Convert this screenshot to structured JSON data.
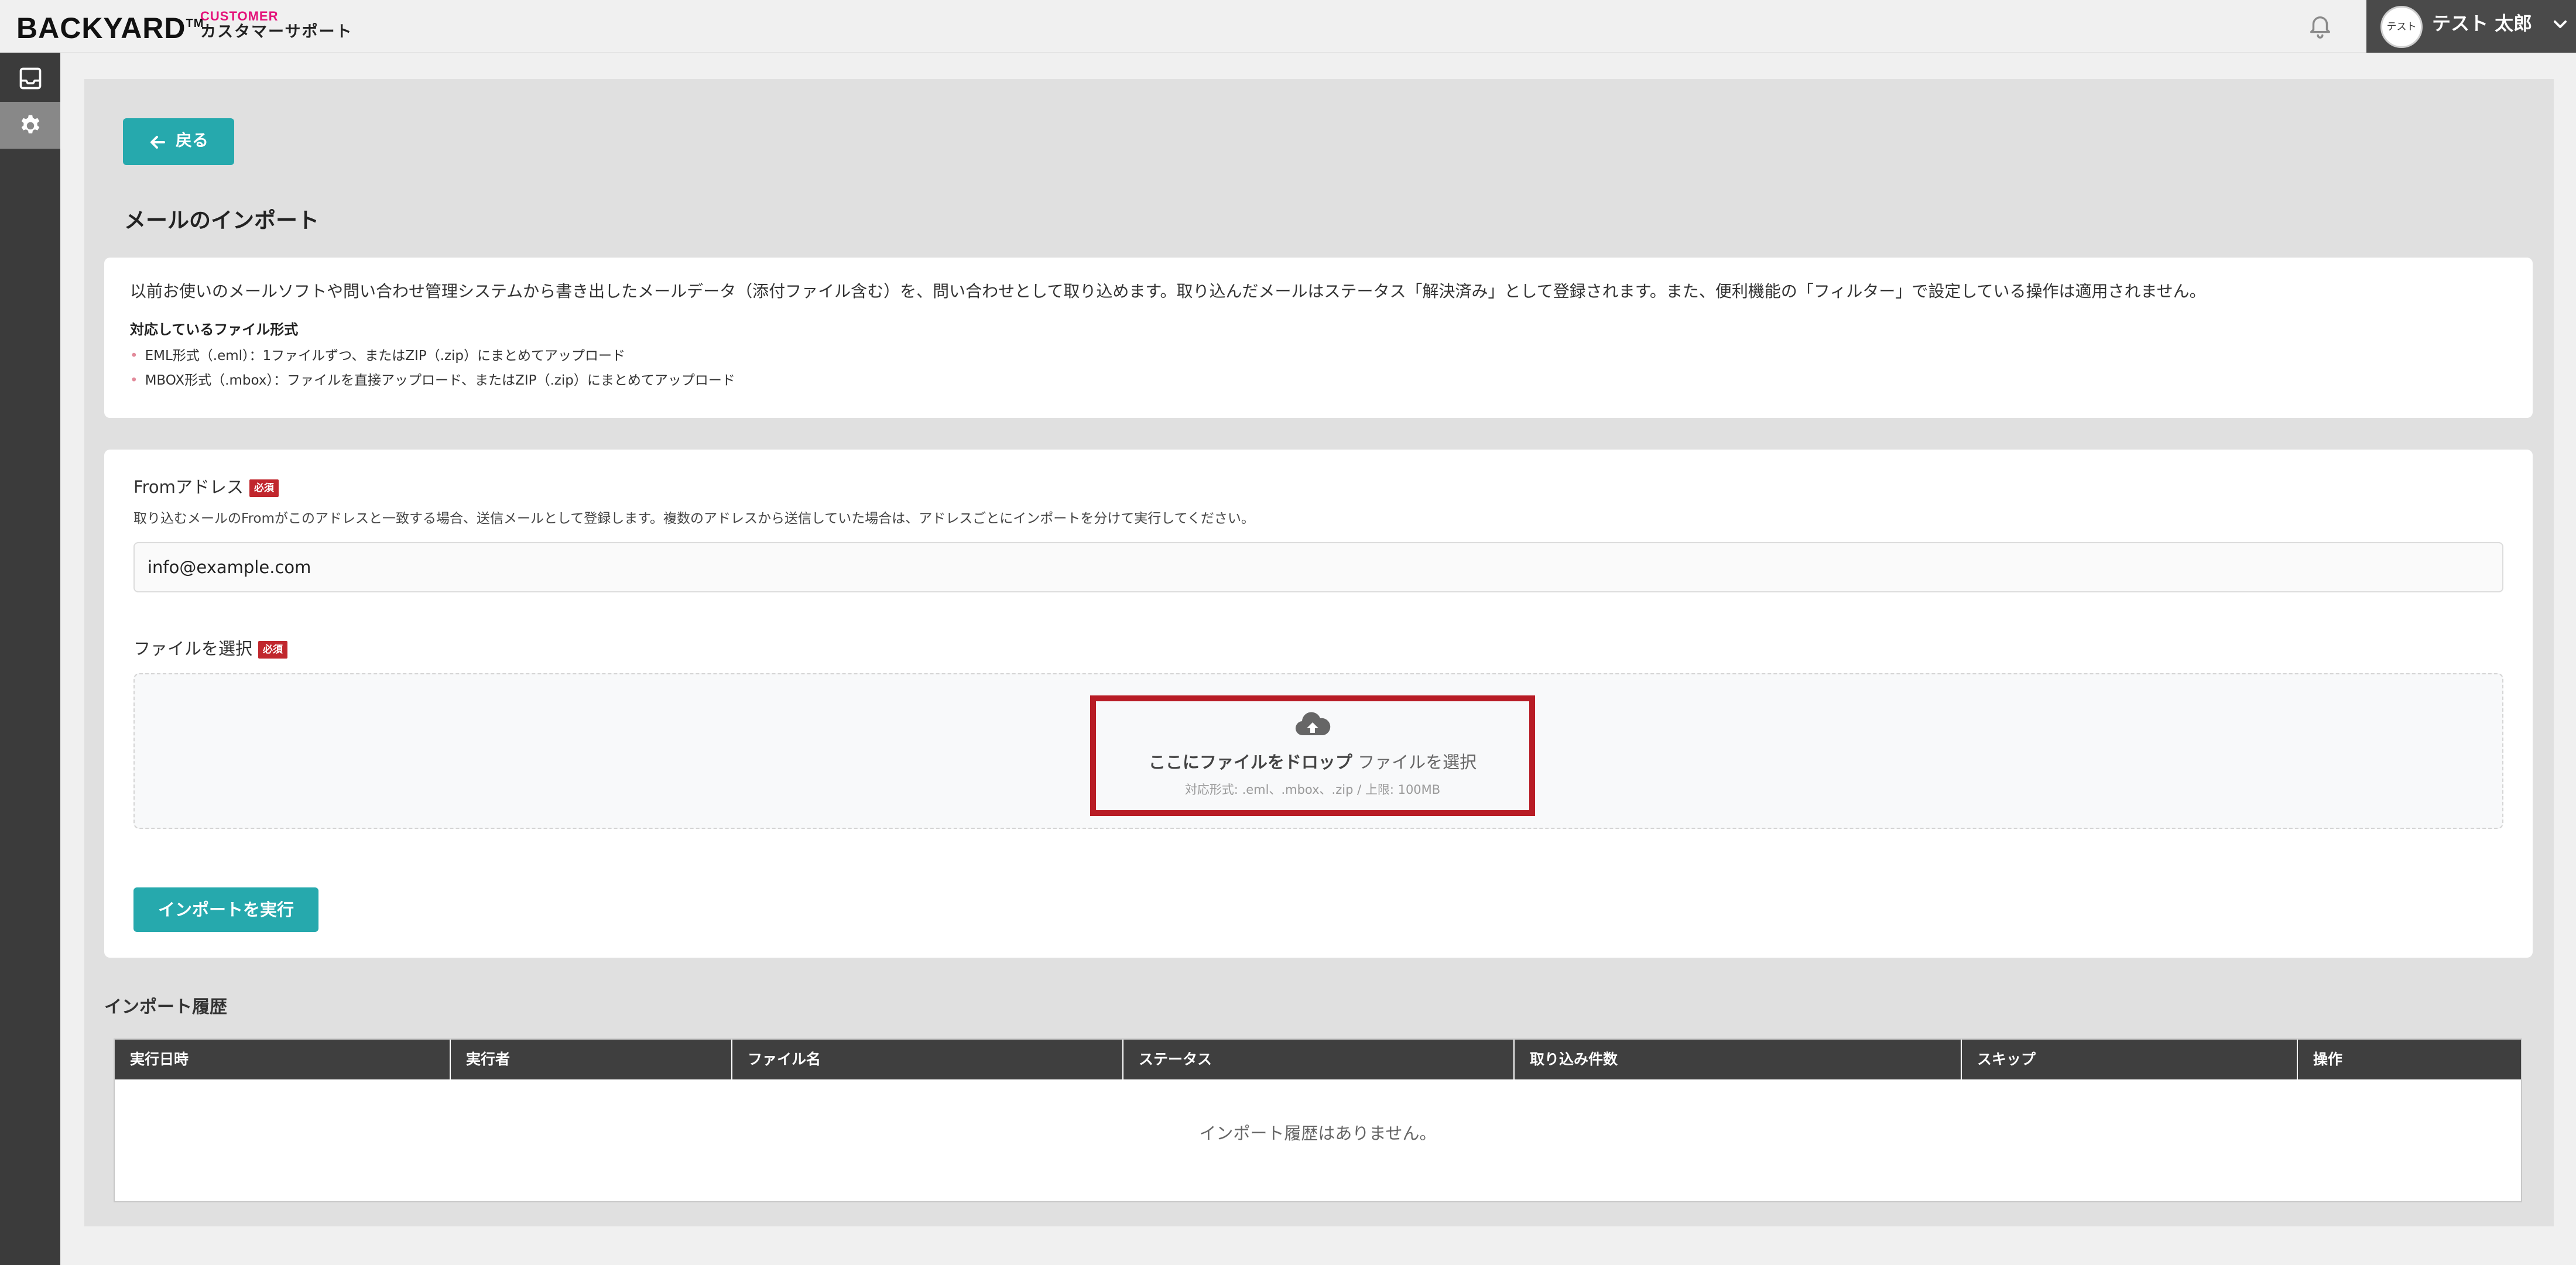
{
  "header": {
    "logo_text": "BACKYARD",
    "logo_tm": "TM",
    "logo_customer": "CUSTOMER",
    "logo_support": "カスタマーサポート",
    "avatar_text": "テスト",
    "user_name": "テスト 太郎"
  },
  "back_button": {
    "label": "戻る"
  },
  "page_title": "メールのインポート",
  "intro": {
    "description": "以前お使いのメールソフトや問い合わせ管理システムから書き出したメールデータ（添付ファイル含む）を、問い合わせとして取り込めます。取り込んだメールはステータス「解決済み」として登録されます。また、便利機能の「フィルター」で設定している操作は適用されません。",
    "formats_title": "対応しているファイル形式",
    "formats": [
      "EML形式（.eml）：1ファイルずつ、またはZIP（.zip）にまとめてアップロード",
      "MBOX形式（.mbox）：ファイルを直接アップロード、またはZIP（.zip）にまとめてアップロード"
    ]
  },
  "form": {
    "from_label": "Fromアドレス",
    "required_badge": "必須",
    "from_help": "取り込むメールのFromがこのアドレスと一致する場合、送信メールとして登録します。複数のアドレスから送信していた場合は、アドレスごとにインポートを分けて実行してください。",
    "from_value": "info@example.com",
    "file_label": "ファイルを選択",
    "drop_bold": "ここにファイルをドロップ",
    "drop_select": "ファイルを選択",
    "drop_hint": "対応形式: .eml、.mbox、.zip / 上限: 100MB",
    "import_button": "インポートを実行"
  },
  "history": {
    "title": "インポート履歴",
    "columns": [
      "実行日時",
      "実行者",
      "ファイル名",
      "ステータス",
      "取り込み件数",
      "スキップ",
      "操作"
    ],
    "empty_text": "インポート履歴はありません。"
  },
  "colors": {
    "accent": "#26a9ad",
    "required": "#c1272d",
    "highlight": "#b81c25",
    "brand_pink": "#e4127a"
  }
}
